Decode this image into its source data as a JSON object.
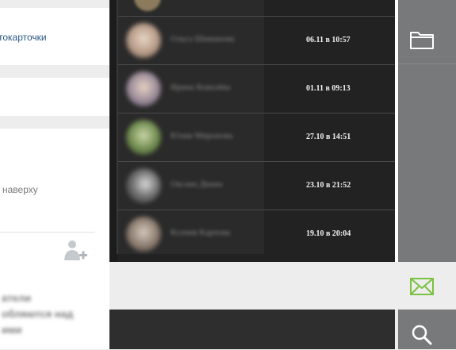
{
  "left_panel": {
    "photos_link": "токарточки",
    "hint_text": "наверху",
    "blurred_text_lines": [
      "атели",
      "обляются над",
      "ими"
    ]
  },
  "dialogs": [
    {
      "name": "Ольга Шиманова",
      "time": "06.11 в 10:57",
      "avatar_color": "#b59a86"
    },
    {
      "name": "Ирина Ковалёва",
      "time": "01.11 в 09:13",
      "avatar_color": "#9a8a98"
    },
    {
      "name": "Юлия Миронова",
      "time": "27.10 в 14:51",
      "avatar_color": "#6f8a4e"
    },
    {
      "name": "Оксана Диана",
      "time": "23.10 в 21:52",
      "avatar_color": "#6c6c6c"
    },
    {
      "name": "Ксения Карпова",
      "time": "19.10 в 20:04",
      "avatar_color": "#8a7a6e"
    }
  ],
  "toolbar": {
    "folder_icon": "folder-icon",
    "mail_icon": "mail-icon",
    "search_icon": "search-icon",
    "mail_color": "#7bc142"
  }
}
